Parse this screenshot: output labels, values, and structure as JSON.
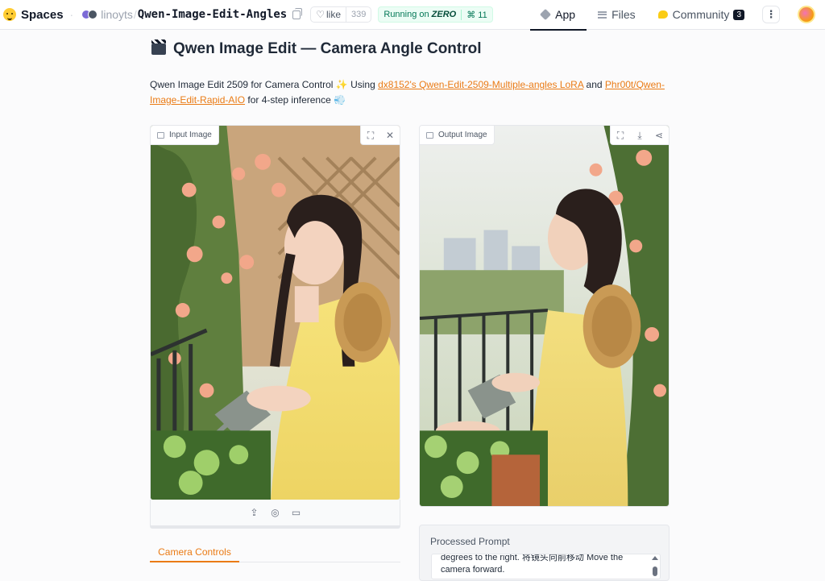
{
  "header": {
    "spaces_label": "Spaces",
    "owner": "linoyts",
    "repo": "Qwen-Image-Edit-Angles",
    "like_label": "like",
    "like_count": "339",
    "running_label": "Running on",
    "running_hw": "ZERO",
    "running_count": "11",
    "nav": {
      "app": "App",
      "files": "Files",
      "community": "Community",
      "community_count": "3"
    },
    "menu_glyph": "⋮"
  },
  "page": {
    "title": "Qwen Image Edit — Camera Angle Control",
    "desc": {
      "part1": "Qwen Image Edit 2509 for Camera Control ",
      "sparkle": "✨",
      "part2": " Using ",
      "link1": "dx8152's Qwen-Edit-2509-Multiple-angles LoRA",
      "part3": " and ",
      "link2": "Phr00t/Qwen-Image-Edit-Rapid-AIO",
      "part4": " for 4-step inference ",
      "gem": "💨"
    }
  },
  "input_panel": {
    "label": "Input Image",
    "tools": {
      "fullscreen": "⛶",
      "close": "✕"
    },
    "footer_icons": {
      "upload": "⇪",
      "webcam": "◎",
      "paste": "▭"
    }
  },
  "output_panel": {
    "label": "Output Image",
    "tools": {
      "fullscreen": "⛶",
      "download": "⤓",
      "share": "⋖"
    }
  },
  "tabs": {
    "camera_controls": "Camera Controls"
  },
  "prompt": {
    "label": "Processed Prompt",
    "line1": "degrees to the right. 将镜头向前移动 Move the",
    "line2": "camera forward."
  },
  "colors": {
    "accent": "#ea7b15",
    "running_bg": "#ecfdf5"
  },
  "icons": {
    "spaces": "hugging-face-icon",
    "copy": "copy-icon",
    "like": "heart-icon",
    "app": "cube-icon",
    "files": "files-icon",
    "community": "chat-icon"
  }
}
